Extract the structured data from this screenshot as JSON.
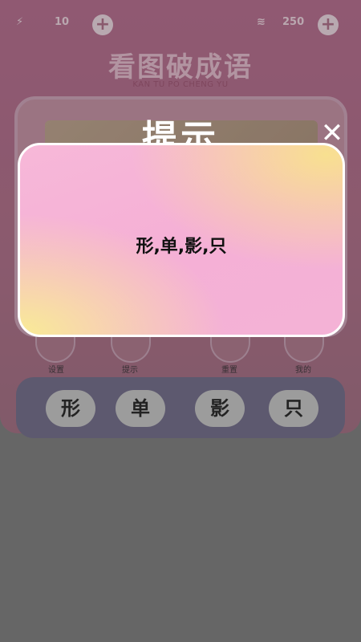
{
  "topbar": {
    "energy_icon": "lightning-icon",
    "energy_count": "10",
    "coin_icon": "coin-stack-icon",
    "coin_count": "250",
    "plus": "+"
  },
  "game": {
    "title": "看图破成语",
    "subtitle": "KAN TU PO CHENG YU",
    "actions": [
      {
        "label": "设置",
        "icon": "settings-icon"
      },
      {
        "label": "提示",
        "icon": "lightbulb-icon"
      },
      {
        "label": "重置",
        "icon": "reset-icon"
      },
      {
        "label": "我的",
        "icon": "profile-icon"
      }
    ],
    "choices": [
      "形",
      "单",
      "影",
      "只"
    ]
  },
  "hint_dialog": {
    "title": "提示",
    "close": "✕",
    "text": "形,单,影,只"
  },
  "colors": {
    "overlay": "#6a6a6a",
    "dialog_pink": "#f5b0d6",
    "dialog_yellow": "#f8e090",
    "choice_panel": "#5e5876"
  }
}
